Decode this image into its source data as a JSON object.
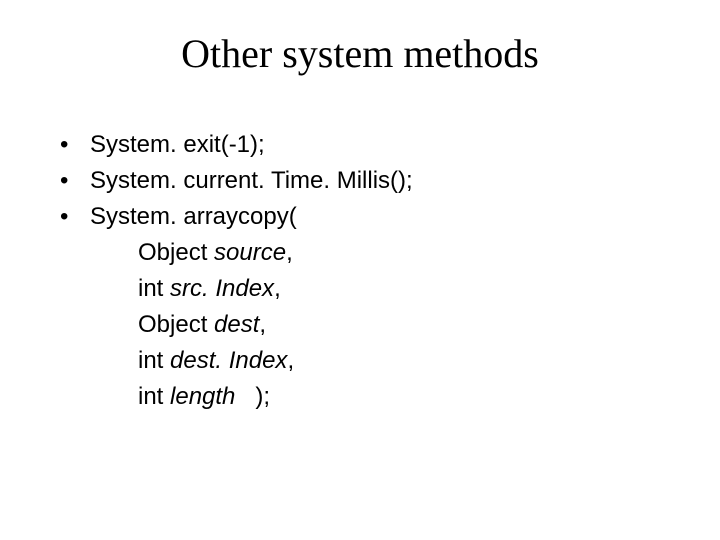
{
  "title": "Other system methods",
  "bullets": {
    "b0": "System. exit(-1);",
    "b1": "System. current. Time. Millis();",
    "b2": "System. arraycopy("
  },
  "params": {
    "p0_prefix": "Object ",
    "p0_name": "source",
    "p0_suffix": ",",
    "p1_prefix": "int ",
    "p1_name": "src. Index",
    "p1_suffix": ",",
    "p2_prefix": "Object ",
    "p2_name": "dest",
    "p2_suffix": ",",
    "p3_prefix": "int ",
    "p3_name": "dest. Index",
    "p3_suffix": ",",
    "p4_prefix": "int ",
    "p4_name": "length",
    "p4_suffix": "   );"
  },
  "bullet_char": "•"
}
